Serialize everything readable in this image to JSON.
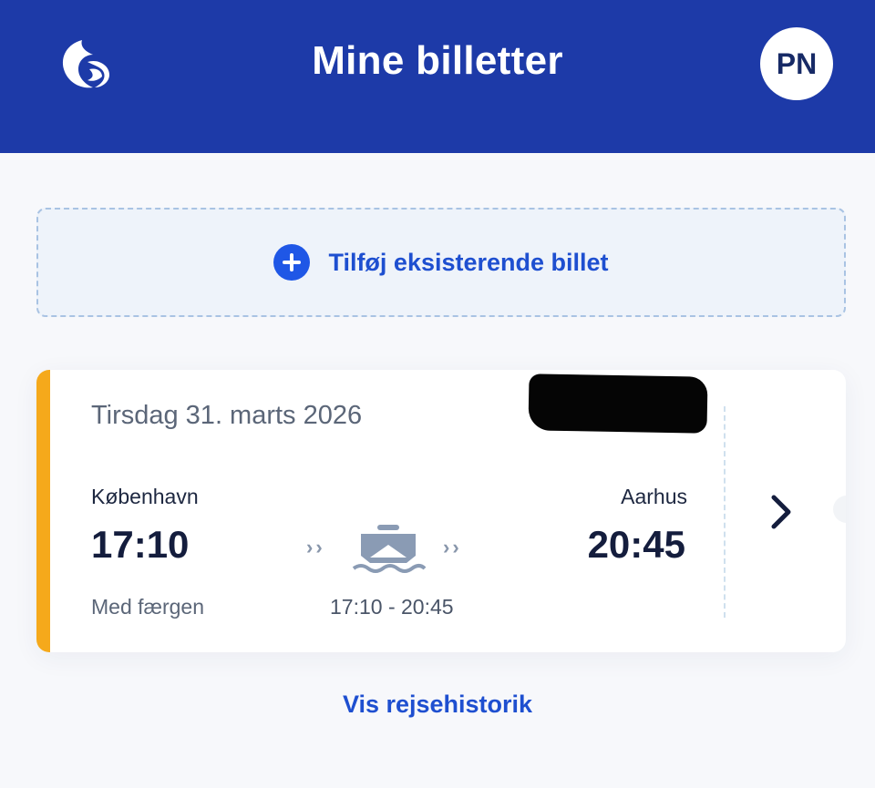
{
  "header": {
    "title": "Mine billetter",
    "avatar_initials": "PN",
    "logo_icon": "wave-logo-icon"
  },
  "add_ticket": {
    "label": "Tilføj eksisterende billet",
    "icon": "plus-circle-icon"
  },
  "ticket": {
    "date": "Tirsdag 31. marts 2026",
    "from_city": "København",
    "to_city": "Aarhus",
    "departure_time": "17:10",
    "arrival_time": "20:45",
    "mode": "Med færgen",
    "time_range": "17:10 - 20:45",
    "transport_icon": "ferry-icon",
    "accent_color": "#f5a91b"
  },
  "footer": {
    "history_link": "Vis rejsehistorik"
  },
  "colors": {
    "header_bg": "#1d3aa8",
    "link": "#1e4fd0"
  }
}
